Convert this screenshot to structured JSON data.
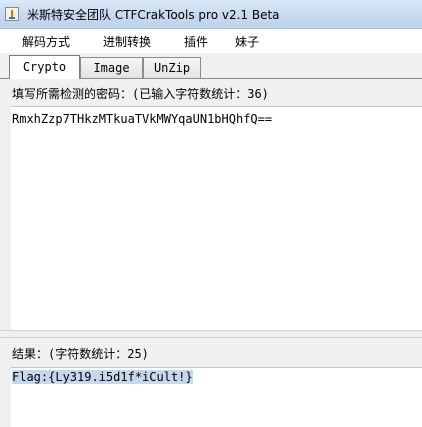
{
  "window": {
    "title": "米斯特安全团队 CTFCrakTools pro v2.1 Beta",
    "icon": "java-cup-icon"
  },
  "menu": {
    "items": [
      "解码方式",
      "进制转换",
      "插件",
      "妹子"
    ]
  },
  "tabs": [
    {
      "label": "Crypto",
      "active": true
    },
    {
      "label": "Image",
      "active": false
    },
    {
      "label": "UnZip",
      "active": false
    }
  ],
  "input_panel": {
    "label": "填写所需检测的密码：(已输入字符数统计：36)",
    "value": "RmxhZzp7THkzMTkuaTVkMWYqaUN1bHQhfQ=="
  },
  "output_panel": {
    "label": "结果：(字符数统计：25)",
    "value": "Flag:{Ly319.i5d1f*iCult!}"
  }
}
